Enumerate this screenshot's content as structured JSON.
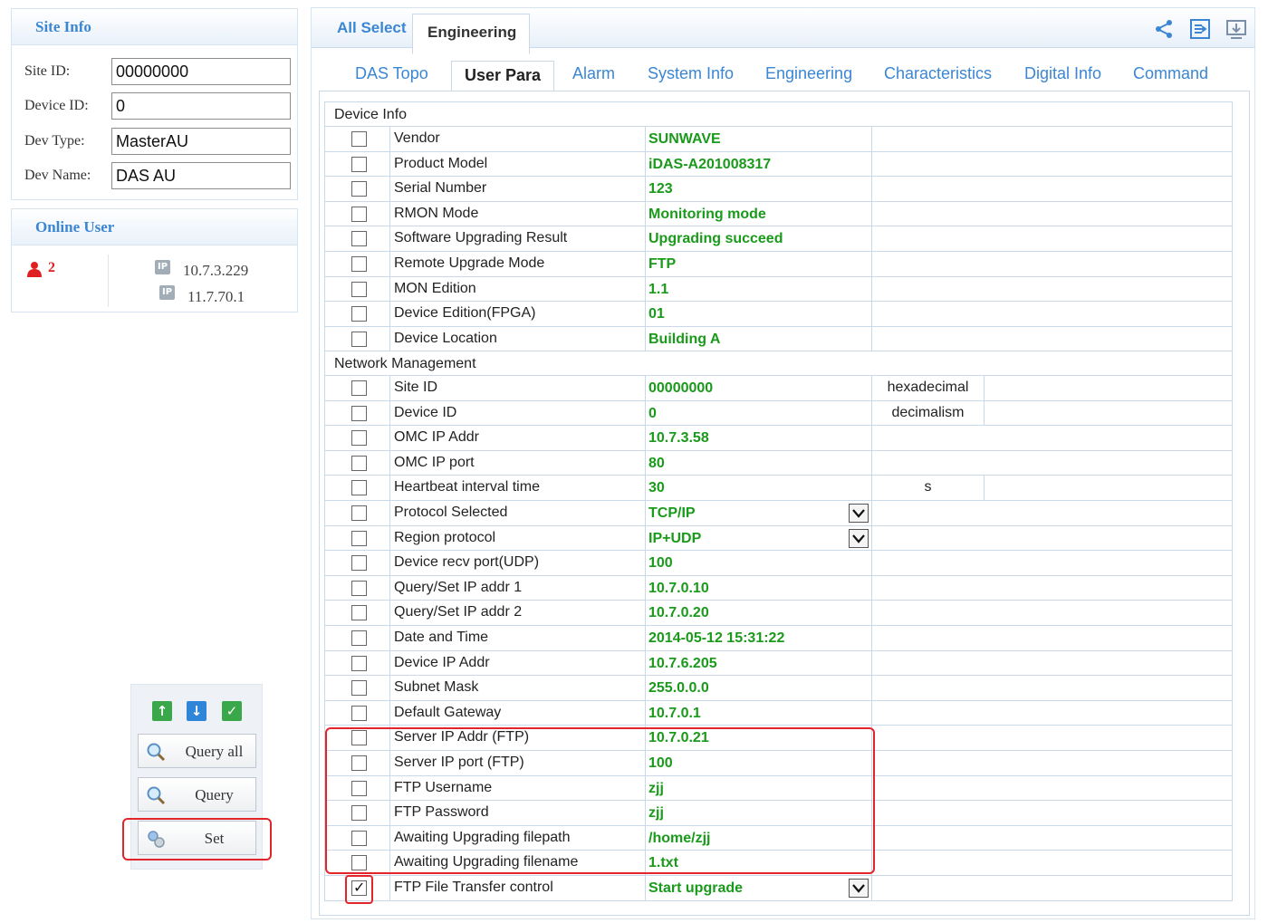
{
  "site_info": {
    "title": "Site Info",
    "fields": [
      {
        "label": "Site ID:",
        "value": "00000000"
      },
      {
        "label": "Device ID:",
        "value": "0"
      },
      {
        "label": "Dev Type:",
        "value": "MasterAU"
      },
      {
        "label": "Dev Name:",
        "value": "DAS AU"
      }
    ]
  },
  "online_user": {
    "title": "Online User",
    "count": "2",
    "ips": [
      "10.7.3.229",
      "11.7.70.1"
    ],
    "ip_badge": "IP"
  },
  "actions": {
    "query_all": "Query all",
    "query": "Query",
    "set": "Set"
  },
  "top_tabs": [
    "All Select",
    "Engineering"
  ],
  "sub_tabs": [
    "DAS Topo",
    "User Para",
    "Alarm",
    "System Info",
    "Engineering",
    "Characteristics",
    "Digital Info",
    "Command"
  ],
  "sections": {
    "device_info": "Device Info",
    "network": "Network Management"
  },
  "device_info_rows": [
    {
      "name": "Vendor",
      "value": "SUNWAVE"
    },
    {
      "name": "Product Model",
      "value": "iDAS-A201008317"
    },
    {
      "name": "Serial Number",
      "value": "123"
    },
    {
      "name": "RMON Mode",
      "value": "Monitoring mode"
    },
    {
      "name": "Software Upgrading Result",
      "value": "Upgrading succeed"
    },
    {
      "name": "Remote Upgrade Mode",
      "value": "FTP"
    },
    {
      "name": "MON Edition",
      "value": "1.1"
    },
    {
      "name": "Device Edition(FPGA)",
      "value": "01"
    },
    {
      "name": "Device Location",
      "value": "Building A"
    }
  ],
  "network_rows": [
    {
      "name": "Site ID",
      "value": "00000000",
      "unit": "hexadecimal"
    },
    {
      "name": "Device ID",
      "value": "0",
      "unit": "decimalism"
    },
    {
      "name": "OMC IP Addr",
      "value": "10.7.3.58"
    },
    {
      "name": "OMC IP port",
      "value": "80"
    },
    {
      "name": "Heartbeat interval time",
      "value": "30",
      "unit": "s"
    },
    {
      "name": "Protocol Selected",
      "value": "TCP/IP",
      "dropdown": true
    },
    {
      "name": "Region protocol",
      "value": "IP+UDP",
      "dropdown": true
    },
    {
      "name": "Device recv port(UDP)",
      "value": "100"
    },
    {
      "name": "Query/Set IP addr 1",
      "value": "10.7.0.10"
    },
    {
      "name": "Query/Set IP addr 2",
      "value": "10.7.0.20"
    },
    {
      "name": "Date and Time",
      "value": "2014-05-12 15:31:22"
    },
    {
      "name": "Device IP Addr",
      "value": "10.7.6.205"
    },
    {
      "name": "Subnet Mask",
      "value": "255.0.0.0"
    },
    {
      "name": "Default Gateway",
      "value": "10.7.0.1"
    },
    {
      "name": "Server IP Addr (FTP)",
      "value": "10.7.0.21"
    },
    {
      "name": "Server IP port (FTP)",
      "value": "100"
    },
    {
      "name": "FTP Username",
      "value": "zjj"
    },
    {
      "name": "FTP Password",
      "value": "zjj"
    },
    {
      "name": "Awaiting Upgrading filepath",
      "value": "/home/zjj"
    },
    {
      "name": "Awaiting Upgrading filename",
      "value": "1.txt"
    },
    {
      "name": "FTP File Transfer control",
      "value": "Start upgrade",
      "dropdown": true,
      "checked": true
    }
  ],
  "colors": {
    "accent_blue": "#3b86d3",
    "value_green": "#1a9a1a",
    "highlight_red": "#e2242b",
    "border_blue": "#c9d9ea"
  },
  "icons": [
    "share-icon",
    "export-icon",
    "download-icon",
    "upload-icon",
    "import-icon",
    "confirm-icon",
    "search-icon",
    "set-icon",
    "user-icon",
    "ip-icon"
  ]
}
